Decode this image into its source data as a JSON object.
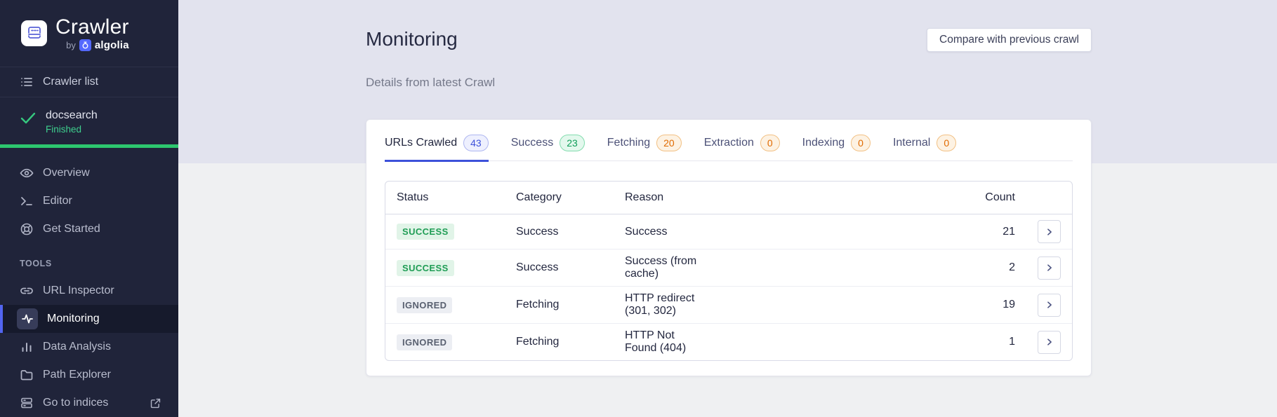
{
  "app": {
    "name": "Crawler",
    "by_label": "by",
    "brand": "algolia"
  },
  "sidebar": {
    "crawler_list_label": "Crawler list",
    "crawl": {
      "name": "docsearch",
      "status": "Finished",
      "progress_percent": 100
    },
    "items_main": [
      {
        "label": "Overview"
      },
      {
        "label": "Editor"
      },
      {
        "label": "Get Started"
      }
    ],
    "tools_title": "TOOLS",
    "items_tools": [
      {
        "label": "URL Inspector"
      },
      {
        "label": "Monitoring",
        "active": true
      },
      {
        "label": "Data Analysis"
      },
      {
        "label": "Path Explorer"
      },
      {
        "label": "Go to indices",
        "external": true
      }
    ]
  },
  "header": {
    "title": "Monitoring",
    "compare_button": "Compare with previous crawl",
    "subtitle": "Details from latest Crawl"
  },
  "tabs": [
    {
      "label": "URLs Crawled",
      "count": "43",
      "color": "blue",
      "active": true
    },
    {
      "label": "Success",
      "count": "23",
      "color": "green",
      "active": false
    },
    {
      "label": "Fetching",
      "count": "20",
      "color": "orange",
      "active": false
    },
    {
      "label": "Extraction",
      "count": "0",
      "color": "orange",
      "active": false
    },
    {
      "label": "Indexing",
      "count": "0",
      "color": "orange",
      "active": false
    },
    {
      "label": "Internal",
      "count": "0",
      "color": "orange",
      "active": false
    }
  ],
  "table": {
    "columns": {
      "status": "Status",
      "category": "Category",
      "reason": "Reason",
      "count": "Count"
    },
    "rows": [
      {
        "status": "SUCCESS",
        "category": "Success",
        "reason": "Success",
        "count": "21"
      },
      {
        "status": "SUCCESS",
        "category": "Success",
        "reason": "Success (from cache)",
        "count": "2"
      },
      {
        "status": "IGNORED",
        "category": "Fetching",
        "reason": "HTTP redirect (301, 302)",
        "count": "19"
      },
      {
        "status": "IGNORED",
        "category": "Fetching",
        "reason": "HTTP Not Found (404)",
        "count": "1"
      }
    ]
  },
  "colors": {
    "sidebar_bg": "#20243a",
    "header_bg": "#e2e3ee",
    "content_bg": "#eff0f2",
    "accent_indigo": "#3d51da",
    "brand_blue": "#5468ff",
    "success_green": "#2dc76f",
    "warning_orange": "#e06a00"
  }
}
